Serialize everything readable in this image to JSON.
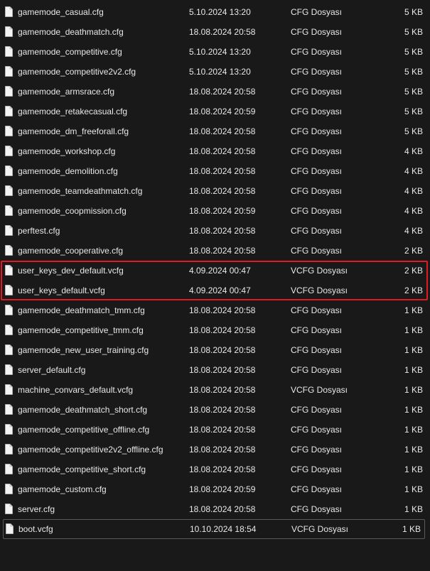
{
  "highlight_color": "#e01b24",
  "files": [
    {
      "name": "gamemode_casual.cfg",
      "modified": "5.10.2024 13:20",
      "type": "CFG Dosyası",
      "size": "5 KB",
      "icon": "file-icon"
    },
    {
      "name": "gamemode_deathmatch.cfg",
      "modified": "18.08.2024 20:58",
      "type": "CFG Dosyası",
      "size": "5 KB",
      "icon": "file-icon"
    },
    {
      "name": "gamemode_competitive.cfg",
      "modified": "5.10.2024 13:20",
      "type": "CFG Dosyası",
      "size": "5 KB",
      "icon": "file-icon"
    },
    {
      "name": "gamemode_competitive2v2.cfg",
      "modified": "5.10.2024 13:20",
      "type": "CFG Dosyası",
      "size": "5 KB",
      "icon": "file-icon"
    },
    {
      "name": "gamemode_armsrace.cfg",
      "modified": "18.08.2024 20:58",
      "type": "CFG Dosyası",
      "size": "5 KB",
      "icon": "file-icon"
    },
    {
      "name": "gamemode_retakecasual.cfg",
      "modified": "18.08.2024 20:59",
      "type": "CFG Dosyası",
      "size": "5 KB",
      "icon": "file-icon"
    },
    {
      "name": "gamemode_dm_freeforall.cfg",
      "modified": "18.08.2024 20:58",
      "type": "CFG Dosyası",
      "size": "5 KB",
      "icon": "file-icon"
    },
    {
      "name": "gamemode_workshop.cfg",
      "modified": "18.08.2024 20:58",
      "type": "CFG Dosyası",
      "size": "4 KB",
      "icon": "file-icon"
    },
    {
      "name": "gamemode_demolition.cfg",
      "modified": "18.08.2024 20:58",
      "type": "CFG Dosyası",
      "size": "4 KB",
      "icon": "file-icon"
    },
    {
      "name": "gamemode_teamdeathmatch.cfg",
      "modified": "18.08.2024 20:58",
      "type": "CFG Dosyası",
      "size": "4 KB",
      "icon": "file-icon"
    },
    {
      "name": "gamemode_coopmission.cfg",
      "modified": "18.08.2024 20:59",
      "type": "CFG Dosyası",
      "size": "4 KB",
      "icon": "file-icon"
    },
    {
      "name": "perftest.cfg",
      "modified": "18.08.2024 20:58",
      "type": "CFG Dosyası",
      "size": "4 KB",
      "icon": "file-icon"
    },
    {
      "name": "gamemode_cooperative.cfg",
      "modified": "18.08.2024 20:58",
      "type": "CFG Dosyası",
      "size": "2 KB",
      "icon": "file-icon"
    },
    {
      "name": "user_keys_dev_default.vcfg",
      "modified": "4.09.2024 00:47",
      "type": "VCFG Dosyası",
      "size": "2 KB",
      "icon": "file-icon"
    },
    {
      "name": "user_keys_default.vcfg",
      "modified": "4.09.2024 00:47",
      "type": "VCFG Dosyası",
      "size": "2 KB",
      "icon": "file-icon"
    },
    {
      "name": "gamemode_deathmatch_tmm.cfg",
      "modified": "18.08.2024 20:58",
      "type": "CFG Dosyası",
      "size": "1 KB",
      "icon": "file-icon"
    },
    {
      "name": "gamemode_competitive_tmm.cfg",
      "modified": "18.08.2024 20:58",
      "type": "CFG Dosyası",
      "size": "1 KB",
      "icon": "file-icon"
    },
    {
      "name": "gamemode_new_user_training.cfg",
      "modified": "18.08.2024 20:58",
      "type": "CFG Dosyası",
      "size": "1 KB",
      "icon": "file-icon"
    },
    {
      "name": "server_default.cfg",
      "modified": "18.08.2024 20:58",
      "type": "CFG Dosyası",
      "size": "1 KB",
      "icon": "file-icon"
    },
    {
      "name": "machine_convars_default.vcfg",
      "modified": "18.08.2024 20:58",
      "type": "VCFG Dosyası",
      "size": "1 KB",
      "icon": "file-icon"
    },
    {
      "name": "gamemode_deathmatch_short.cfg",
      "modified": "18.08.2024 20:58",
      "type": "CFG Dosyası",
      "size": "1 KB",
      "icon": "file-icon"
    },
    {
      "name": "gamemode_competitive_offline.cfg",
      "modified": "18.08.2024 20:58",
      "type": "CFG Dosyası",
      "size": "1 KB",
      "icon": "file-icon"
    },
    {
      "name": "gamemode_competitive2v2_offline.cfg",
      "modified": "18.08.2024 20:58",
      "type": "CFG Dosyası",
      "size": "1 KB",
      "icon": "file-icon"
    },
    {
      "name": "gamemode_competitive_short.cfg",
      "modified": "18.08.2024 20:58",
      "type": "CFG Dosyası",
      "size": "1 KB",
      "icon": "file-icon"
    },
    {
      "name": "gamemode_custom.cfg",
      "modified": "18.08.2024 20:59",
      "type": "CFG Dosyası",
      "size": "1 KB",
      "icon": "file-icon"
    },
    {
      "name": "server.cfg",
      "modified": "18.08.2024 20:58",
      "type": "CFG Dosyası",
      "size": "1 KB",
      "icon": "file-icon"
    },
    {
      "name": "boot.vcfg",
      "modified": "10.10.2024 18:54",
      "type": "VCFG Dosyası",
      "size": "1 KB",
      "icon": "file-icon"
    }
  ]
}
